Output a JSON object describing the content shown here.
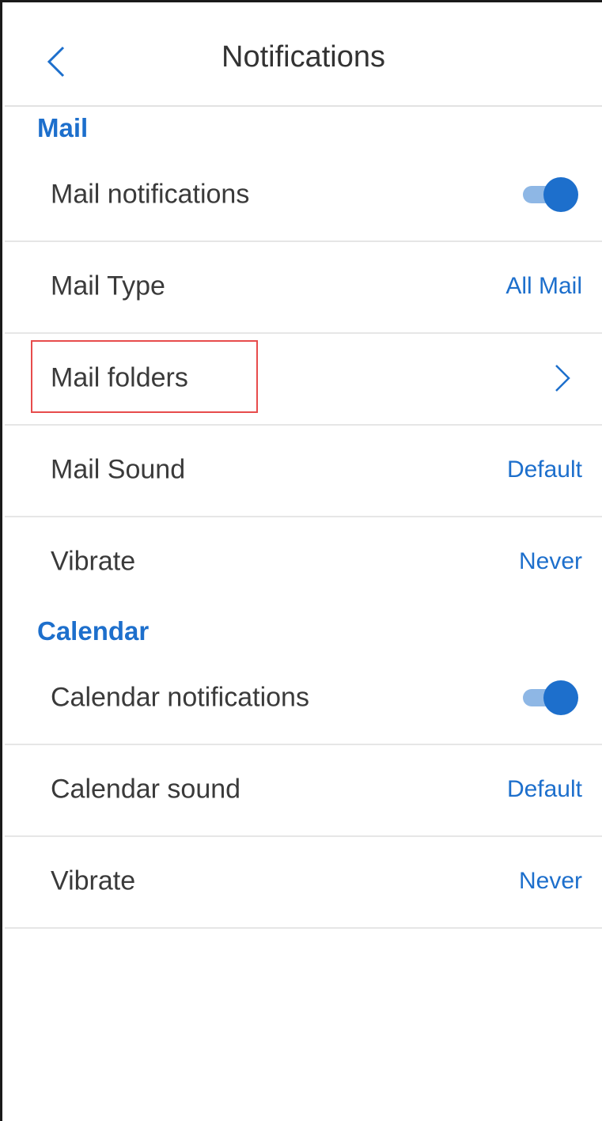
{
  "header": {
    "title": "Notifications",
    "back_icon": "chevron-left-icon"
  },
  "colors": {
    "accent": "#1d6fcc",
    "highlight_border": "#e74c4c",
    "text": "#3a3a3a"
  },
  "sections": {
    "mail": {
      "heading": "Mail",
      "notifications": {
        "label": "Mail notifications",
        "enabled": true
      },
      "type": {
        "label": "Mail Type",
        "value": "All Mail"
      },
      "folders": {
        "label": "Mail folders",
        "icon": "chevron-right-icon"
      },
      "sound": {
        "label": "Mail Sound",
        "value": "Default"
      },
      "vibrate": {
        "label": "Vibrate",
        "value": "Never"
      }
    },
    "calendar": {
      "heading": "Calendar",
      "notifications": {
        "label": "Calendar notifications",
        "enabled": true
      },
      "sound": {
        "label": "Calendar sound",
        "value": "Default"
      },
      "vibrate": {
        "label": "Vibrate",
        "value": "Never"
      }
    }
  }
}
